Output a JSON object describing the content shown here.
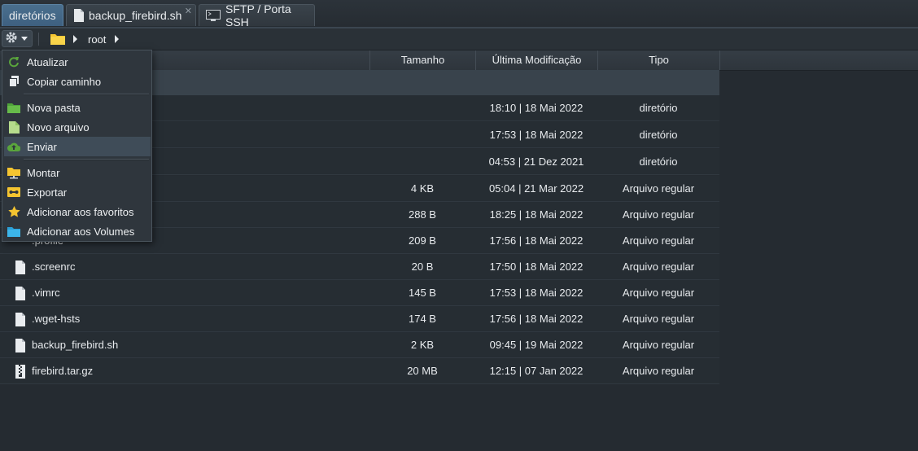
{
  "tabs": [
    {
      "label": "diretórios"
    },
    {
      "label": "backup_firebird.sh",
      "close": "✕"
    },
    {
      "label": "SFTP / Porta SSH"
    }
  ],
  "breadcrumb": {
    "path": [
      "root"
    ]
  },
  "menu": {
    "items": [
      {
        "label": "Atualizar",
        "icon": "refresh-icon"
      },
      {
        "label": "Copiar caminho",
        "icon": "copy-icon"
      },
      {
        "label": "Nova pasta",
        "icon": "new-folder-icon"
      },
      {
        "label": "Novo arquivo",
        "icon": "new-file-icon"
      },
      {
        "label": "Enviar",
        "icon": "upload-cloud-icon"
      },
      {
        "label": "Montar",
        "icon": "mount-icon"
      },
      {
        "label": "Exportar",
        "icon": "export-icon"
      },
      {
        "label": "Adicionar aos favoritos",
        "icon": "star-icon"
      },
      {
        "label": "Adicionar aos Volumes",
        "icon": "volume-folder-icon"
      }
    ]
  },
  "table": {
    "headers": {
      "size": "Tamanho",
      "modified": "Última Modificação",
      "type": "Tipo"
    },
    "rows": [
      {
        "name": "",
        "size": "",
        "modified": "18:10 | 18 Mai 2022",
        "type": "diretório"
      },
      {
        "name": "",
        "size": "",
        "modified": "17:53 | 18 Mai 2022",
        "type": "diretório"
      },
      {
        "name": "",
        "size": "",
        "modified": "04:53 | 21 Dez 2021",
        "type": "diretório"
      },
      {
        "name": "",
        "size": "4 KB",
        "modified": "05:04 | 21 Mar 2022",
        "type": "Arquivo regular"
      },
      {
        "name": "",
        "size": "288 B",
        "modified": "18:25 | 18 Mai 2022",
        "type": "Arquivo regular"
      },
      {
        "name": ".profile",
        "size": "209 B",
        "modified": "17:56 | 18 Mai 2022",
        "type": "Arquivo regular"
      },
      {
        "name": ".screenrc",
        "size": "20 B",
        "modified": "17:50 | 18 Mai 2022",
        "type": "Arquivo regular"
      },
      {
        "name": ".vimrc",
        "size": "145 B",
        "modified": "17:53 | 18 Mai 2022",
        "type": "Arquivo regular"
      },
      {
        "name": ".wget-hsts",
        "size": "174 B",
        "modified": "17:56 | 18 Mai 2022",
        "type": "Arquivo regular"
      },
      {
        "name": "backup_firebird.sh",
        "size": "2 KB",
        "modified": "09:45 | 19 Mai 2022",
        "type": "Arquivo regular"
      },
      {
        "name": "firebird.tar.gz",
        "size": "20 MB",
        "modified": "12:15 | 07 Jan 2022",
        "type": "Arquivo regular"
      }
    ]
  },
  "colors": {
    "accent_tab": "#4a6f8e",
    "folder": "#f4c430",
    "menu_hover": "#3f4c58"
  }
}
